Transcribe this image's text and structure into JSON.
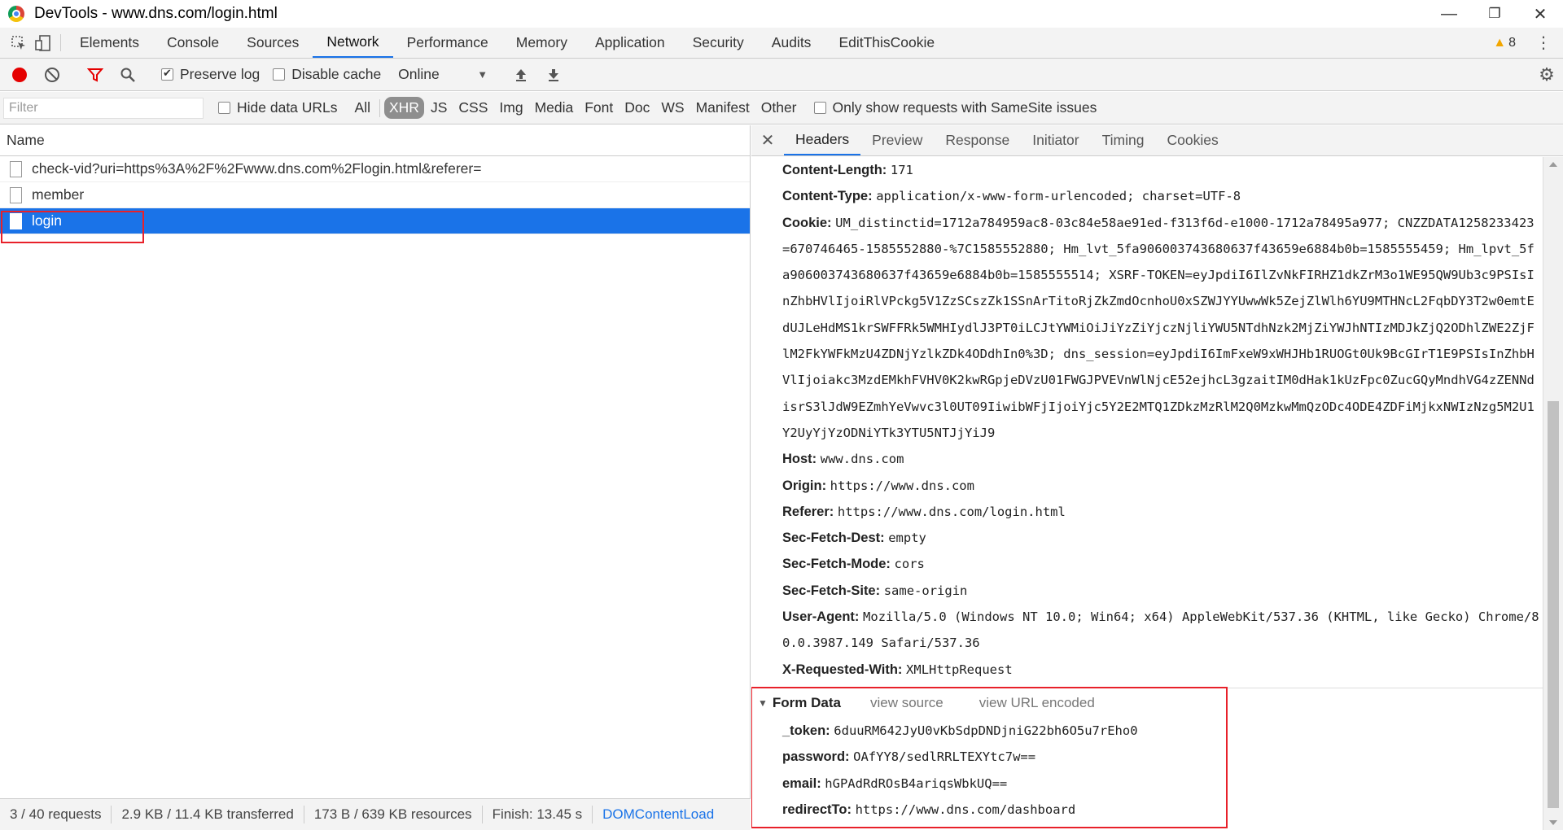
{
  "window": {
    "title": "DevTools - www.dns.com/login.html"
  },
  "main_tabs": [
    "Elements",
    "Console",
    "Sources",
    "Network",
    "Performance",
    "Memory",
    "Application",
    "Security",
    "Audits",
    "EditThisCookie"
  ],
  "warnings": {
    "count": "8"
  },
  "toolbar": {
    "preserve_log": "Preserve log",
    "disable_cache": "Disable cache",
    "throttle": "Online"
  },
  "filter": {
    "placeholder": "Filter",
    "hide_data_urls": "Hide data URLs",
    "types": [
      "All",
      "XHR",
      "JS",
      "CSS",
      "Img",
      "Media",
      "Font",
      "Doc",
      "WS",
      "Manifest",
      "Other"
    ],
    "samesite": "Only show requests with SameSite issues"
  },
  "requests": {
    "column": "Name",
    "rows": [
      "check-vid?uri=https%3A%2F%2Fwww.dns.com%2Flogin.html&referer=",
      "member",
      "login"
    ]
  },
  "status": {
    "requests": "3 / 40 requests",
    "transferred": "2.9 KB / 11.4 KB transferred",
    "resources": "173 B / 639 KB resources",
    "finish": "Finish: 13.45 s",
    "dom": "DOMContentLoad"
  },
  "detail_tabs": [
    "Headers",
    "Preview",
    "Response",
    "Initiator",
    "Timing",
    "Cookies"
  ],
  "headers": [
    {
      "name": "Content-Length:",
      "value": "171"
    },
    {
      "name": "Content-Type:",
      "value": "application/x-www-form-urlencoded; charset=UTF-8"
    },
    {
      "name": "Cookie:",
      "value": "UM_distinctid=1712a784959ac8-03c84e58ae91ed-f313f6d-e1000-1712a78495a977; CNZZDATA1258233423=670746465-1585552880-%7C1585552880; Hm_lvt_5fa906003743680637f43659e6884b0b=1585555459; Hm_lpvt_5fa906003743680637f43659e6884b0b=1585555514; XSRF-TOKEN=eyJpdiI6IlZvNkFIRHZ1dkZrM3o1WE95QW9Ub3c9PSIsInZhbHVlIjoiRlVPckg5V1ZzSCszZk1SSnArTitoRjZkZmdOcnhoU0xSZWJYYUwwWk5ZejZlWlh6YU9MTHNcL2FqbDY3T2w0emtEdUJLeHdMS1krSWFFRk5WMHIydlJ3PT0iLCJtYWMiOiJiYzZiYjczNjliYWU5NTdhNzk2MjZiYWJhNTIzMDJkZjQ2ODhlZWE2ZjFlM2FkYWFkMzU4ZDNjYzlkZDk4ODdhIn0%3D; dns_session=eyJpdiI6ImFxeW9xWHJHb1RUOGt0Uk9BcGIrT1E9PSIsInZhbHVlIjoiakc3MzdEMkhFVHV0K2kwRGpjeDVzU01FWGJPVEVnWlNjcE52ejhcL3gzaitIM0dHak1kUzFpc0ZucGQyMndhVG4zZENNdisrS3lJdW9EZmhYeVwvc3l0UT09IiwibWFjIjoiYjc5Y2E2MTQ1ZDkzMzRlM2Q0MzkwMmQzODc4ODE4ZDFiMjkxNWIzNzg5M2U1Y2UyYjYzODNiYTk3YTU5NTJjYiJ9"
    },
    {
      "name": "Host:",
      "value": "www.dns.com"
    },
    {
      "name": "Origin:",
      "value": "https://www.dns.com"
    },
    {
      "name": "Referer:",
      "value": "https://www.dns.com/login.html"
    },
    {
      "name": "Sec-Fetch-Dest:",
      "value": "empty"
    },
    {
      "name": "Sec-Fetch-Mode:",
      "value": "cors"
    },
    {
      "name": "Sec-Fetch-Site:",
      "value": "same-origin"
    },
    {
      "name": "User-Agent:",
      "value": "Mozilla/5.0 (Windows NT 10.0; Win64; x64) AppleWebKit/537.36 (KHTML, like Gecko) Chrome/80.0.3987.149 Safari/537.36"
    },
    {
      "name": "X-Requested-With:",
      "value": "XMLHttpRequest"
    }
  ],
  "form_data": {
    "title": "Form Data",
    "view_source": "view source",
    "view_url_encoded": "view URL encoded",
    "fields": [
      {
        "name": "_token:",
        "value": "6duuRM642JyU0vKbSdpDNDjniG22bh6O5u7rEho0"
      },
      {
        "name": "password:",
        "value": "OAfYY8/sedlRRLTEXYtc7w=="
      },
      {
        "name": "email:",
        "value": "hGPAdRdROsB4ariqsWbkUQ=="
      },
      {
        "name": "redirectTo:",
        "value": "https://www.dns.com/dashboard"
      }
    ]
  },
  "colors": {
    "accent": "#1a73e8",
    "record": "#e50000",
    "highlight": "#e8212a",
    "filter_icon": "#e50000"
  }
}
